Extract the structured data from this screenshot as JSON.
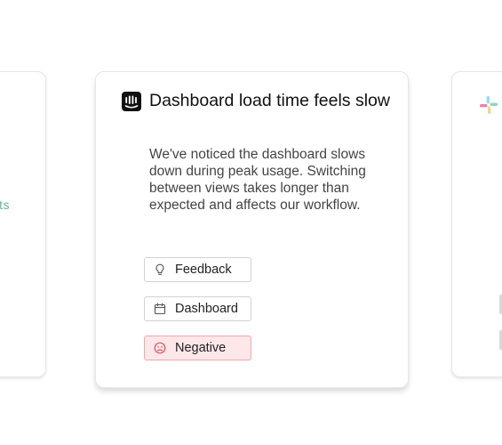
{
  "left_card": {
    "peek_text": "ts"
  },
  "main_card": {
    "title": "Dashboard load time feels slow",
    "body": "We've noticed the dashboard slows down during peak usage. Switching between views takes longer than expected and affects our workflow.",
    "source_icon": "intercom-icon",
    "tags": [
      {
        "label": "Feedback",
        "icon": "lightbulb-icon"
      },
      {
        "label": "Dashboard",
        "icon": "calendar-icon"
      },
      {
        "label": "Negative",
        "icon": "frown-face-icon"
      }
    ]
  },
  "right_card": {
    "source_icon": "slack-icon"
  },
  "colors": {
    "negative_bg": "#fde7e9",
    "negative_border": "#f3a5ad",
    "negative_icon": "#e0505e",
    "peek_text": "#6bb39a"
  }
}
